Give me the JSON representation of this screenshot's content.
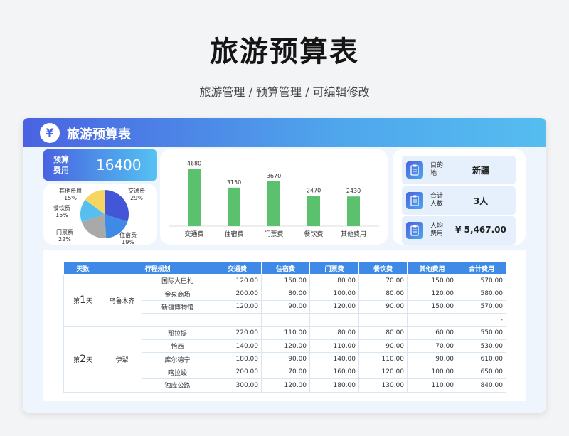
{
  "page": {
    "title": "旅游预算表",
    "subtitle": "旅游管理 / 预算管理 /  可编辑修改"
  },
  "card": {
    "header_icon": "¥",
    "header_icon_name": "yen-icon",
    "title": "旅游预算表"
  },
  "budget": {
    "label": "预算费用",
    "value": "16400"
  },
  "pie": {
    "labels": [
      {
        "name": "交通费",
        "pct": "29%"
      },
      {
        "name": "住宿费",
        "pct": "19%"
      },
      {
        "name": "门票费",
        "pct": "22%"
      },
      {
        "name": "餐饮费",
        "pct": "15%"
      },
      {
        "name": "其他费用",
        "pct": "15%"
      }
    ]
  },
  "info": [
    {
      "label": "目的地",
      "value": "新疆",
      "icon": "clipboard-icon"
    },
    {
      "label": "合计人数",
      "value": "3人",
      "icon": "clipboard-icon"
    },
    {
      "label": "人均费用",
      "value": "¥ 5,467.00",
      "icon": "clipboard-icon"
    }
  ],
  "table": {
    "headers": [
      "天数",
      "行程规划",
      "",
      "交通费",
      "住宿费",
      "门票费",
      "餐饮费",
      "其他费用",
      "合计费用"
    ],
    "day1": {
      "prefix": "第",
      "num": "1",
      "suffix": "天",
      "city": "乌鲁木齐"
    },
    "day2": {
      "prefix": "第",
      "num": "2",
      "suffix": "天",
      "city": "伊犁"
    },
    "rows": [
      [
        "国际大巴扎",
        "120.00",
        "150.00",
        "80.00",
        "70.00",
        "150.00",
        "570.00"
      ],
      [
        "金泉商场",
        "200.00",
        "80.00",
        "100.00",
        "80.00",
        "120.00",
        "580.00"
      ],
      [
        "新疆博物馆",
        "120.00",
        "90.00",
        "120.00",
        "90.00",
        "150.00",
        "570.00"
      ],
      [
        "",
        "",
        "",
        "",
        "",
        "",
        "-"
      ],
      [
        "那拉提",
        "220.00",
        "110.00",
        "80.00",
        "80.00",
        "60.00",
        "550.00"
      ],
      [
        "恰西",
        "140.00",
        "120.00",
        "110.00",
        "90.00",
        "70.00",
        "530.00"
      ],
      [
        "库尔德宁",
        "180.00",
        "90.00",
        "140.00",
        "110.00",
        "90.00",
        "610.00"
      ],
      [
        "喀拉峻",
        "200.00",
        "70.00",
        "160.00",
        "120.00",
        "100.00",
        "650.00"
      ],
      [
        "独库公路",
        "300.00",
        "120.00",
        "180.00",
        "130.00",
        "110.00",
        "840.00"
      ]
    ]
  },
  "colors": {
    "bar": "#5cc16e",
    "pie": [
      "#4456d8",
      "#3f8ae6",
      "#a9a9a9",
      "#55c0ef",
      "#f6d561"
    ],
    "table_header": "#3f8ae6"
  },
  "chart_data": {
    "type": "bar",
    "categories": [
      "交通费",
      "住宿费",
      "门票费",
      "餐饮费",
      "其他费用"
    ],
    "values": [
      4680,
      3150,
      3670,
      2470,
      2430
    ],
    "ylim": [
      0,
      5000
    ]
  }
}
